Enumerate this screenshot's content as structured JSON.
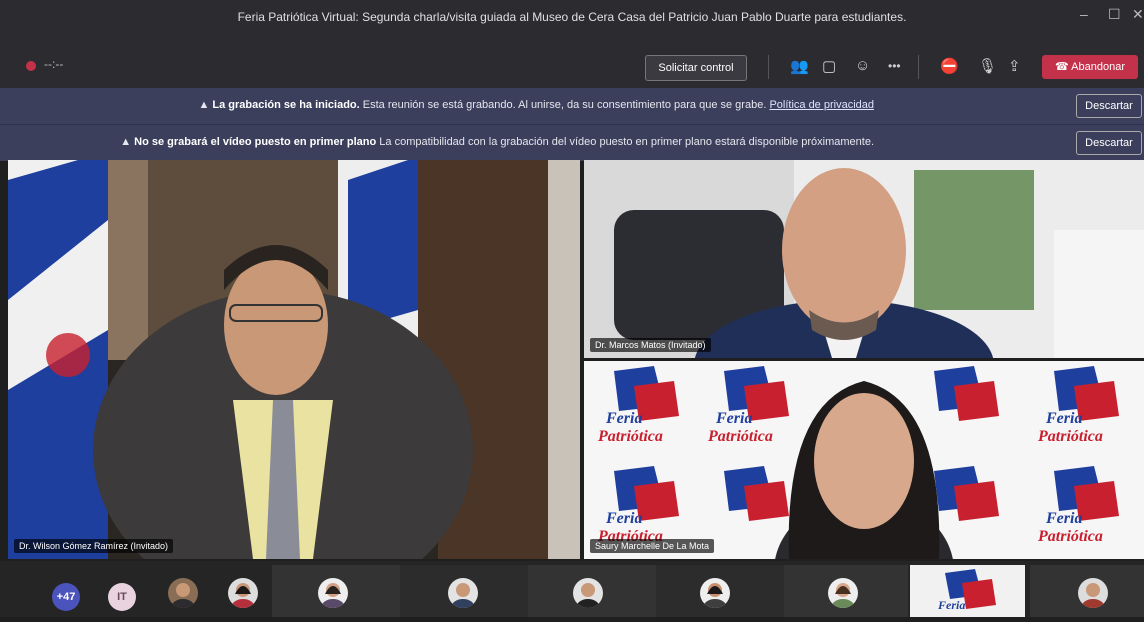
{
  "window": {
    "title": "Feria Patriótica Virtual: Segunda charla/visita guiada al Museo de Cera Casa del Patricio Juan Pablo Duarte para estudiantes.",
    "minimize": "–",
    "maximize": "☐",
    "close": "✕"
  },
  "toolbar": {
    "timer": "--:--",
    "request_control": "Solicitar control",
    "more": "•••",
    "leave": "Abandonar"
  },
  "banners": [
    {
      "bold": "La grabación se ha iniciado.",
      "text": " Esta reunión se está grabando. Al unirse, da su consentimiento para que se grabe.",
      "link": "Política de privacidad",
      "dismiss": "Descartar"
    },
    {
      "bold": "No se grabará el vídeo puesto en primer plano",
      "text": " La compatibilidad con la grabación del vídeo puesto en primer plano estará disponible próximamente.",
      "link": "",
      "dismiss": "Descartar"
    }
  ],
  "participants": {
    "main": "Dr. Wilson Gómez Ramírez (Invitado)",
    "top_right": "Dr. Marcos Matos (Invitado)",
    "bottom_right": "Saury Marchelle De La Mota"
  },
  "strip": {
    "overflow_count": "+47",
    "initials": "IT"
  },
  "logo_text": [
    "Feria",
    "Patriótica"
  ],
  "colors": {
    "accent_red": "#c4314b",
    "banner_bg": "#3b3f5c",
    "flag_blue": "#1f3f9e",
    "flag_red": "#c8202f"
  }
}
